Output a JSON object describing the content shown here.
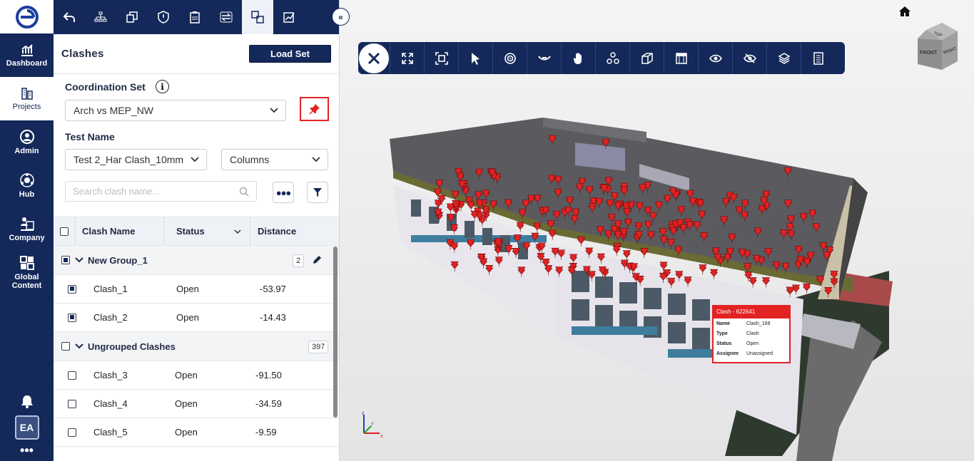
{
  "nav": {
    "items": [
      {
        "label": "Dashboard",
        "icon": "dashboard-icon"
      },
      {
        "label": "Projects",
        "icon": "projects-icon"
      },
      {
        "label": "Admin",
        "icon": "admin-icon"
      },
      {
        "label": "Hub",
        "icon": "hub-icon"
      },
      {
        "label": "Company",
        "icon": "company-icon"
      },
      {
        "label": "Global Content",
        "icon": "global-content-icon"
      }
    ],
    "avatar": "EA"
  },
  "panel": {
    "title": "Clashes",
    "load_set_label": "Load Set",
    "coordination_set_label": "Coordination Set",
    "coordination_set_value": "Arch vs MEP_NW",
    "test_name_label": "Test Name",
    "test_name_value": "Test 2_Har Clash_10mm",
    "columns_label": "Columns",
    "search_placeholder": "Search clash name...",
    "table": {
      "headers": {
        "name": "Clash Name",
        "status": "Status",
        "distance": "Distance"
      },
      "groups": [
        {
          "name": "New Group_1",
          "count": "2",
          "rows": [
            {
              "name": "Clash_1",
              "status": "Open",
              "distance": "-53.97"
            },
            {
              "name": "Clash_2",
              "status": "Open",
              "distance": "-14.43"
            }
          ]
        },
        {
          "name": "Ungrouped Clashes",
          "count": "397",
          "rows": [
            {
              "name": "Clash_3",
              "status": "Open",
              "distance": "-91.50"
            },
            {
              "name": "Clash_4",
              "status": "Open",
              "distance": "-34.59"
            },
            {
              "name": "Clash_5",
              "status": "Open",
              "distance": "-9.59"
            }
          ]
        }
      ]
    }
  },
  "viewer": {
    "viewcube": {
      "top": "TOP",
      "front": "FRONT",
      "right": "RIGHT"
    },
    "axes": {
      "z": "z",
      "y": "y",
      "x": "x"
    },
    "popup": {
      "title": "Clash - 622641",
      "fields": [
        {
          "key": "Name",
          "value": "Clash_168"
        },
        {
          "key": "Type",
          "value": "Clash"
        },
        {
          "key": "Status",
          "value": "Open"
        },
        {
          "key": "Assignee",
          "value": "Unassigned"
        }
      ]
    }
  },
  "colors": {
    "navy": "#14285a",
    "clash_red": "#e32222",
    "roof": "#5a5a5e"
  }
}
